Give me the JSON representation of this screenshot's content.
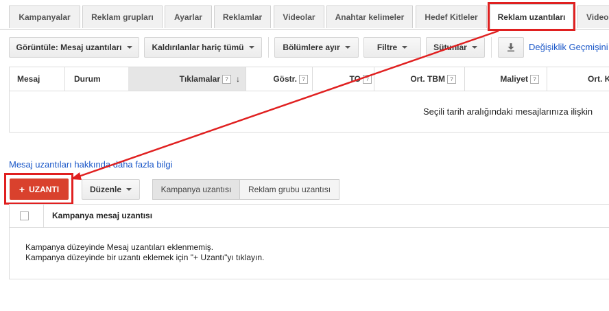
{
  "tabs": [
    {
      "label": "Kampanyalar"
    },
    {
      "label": "Reklam grupları"
    },
    {
      "label": "Ayarlar"
    },
    {
      "label": "Reklamlar"
    },
    {
      "label": "Videolar"
    },
    {
      "label": "Anahtar kelimeler"
    },
    {
      "label": "Hedef Kitleler"
    },
    {
      "label": "Reklam uzantıları",
      "active": true
    },
    {
      "label": "Video"
    }
  ],
  "toolbar": {
    "view_label": "Görüntüle: Mesaj uzantıları",
    "filter_removed_label": "Kaldırılanlar hariç tümü",
    "segment_label": "Bölümlere ayır",
    "filter_label": "Filtre",
    "columns_label": "Sütunlar",
    "history_link": "Değişiklik Geçmişini"
  },
  "stats_table": {
    "headers": {
      "message": "Mesaj",
      "status": "Durum",
      "clicks": "Tıklamalar",
      "impressions": "Göstr.",
      "ctr": "TO",
      "avg_cpc": "Ort. TBM",
      "cost": "Maliyet",
      "avg_more": "Ort. K"
    },
    "help_glyph": "?",
    "sort_glyph": "↓",
    "empty_message": "Seçili tarih aralığındaki mesajlarınıza ilişkin"
  },
  "learn_more_link": "Mesaj uzantıları hakkında daha fazla bilgi",
  "add_button_icon": "+",
  "add_button_label": "UZANTI",
  "edit_button_label": "Düzenle",
  "level_tabs": {
    "campaign": "Kampanya uzantısı",
    "adgroup": "Reklam grubu uzantısı"
  },
  "ext_table": {
    "header": "Kampanya mesaj uzantısı",
    "empty_line1": "Kampanya düzeyinde Mesaj uzantıları eklenmemiş.",
    "empty_line2": "Kampanya düzeyinde bir uzantı eklemek için \"+ Uzantı\"yı tıklayın."
  },
  "colors": {
    "highlight": "#e02020",
    "add_button": "#d9412d",
    "link": "#1a57c8"
  }
}
